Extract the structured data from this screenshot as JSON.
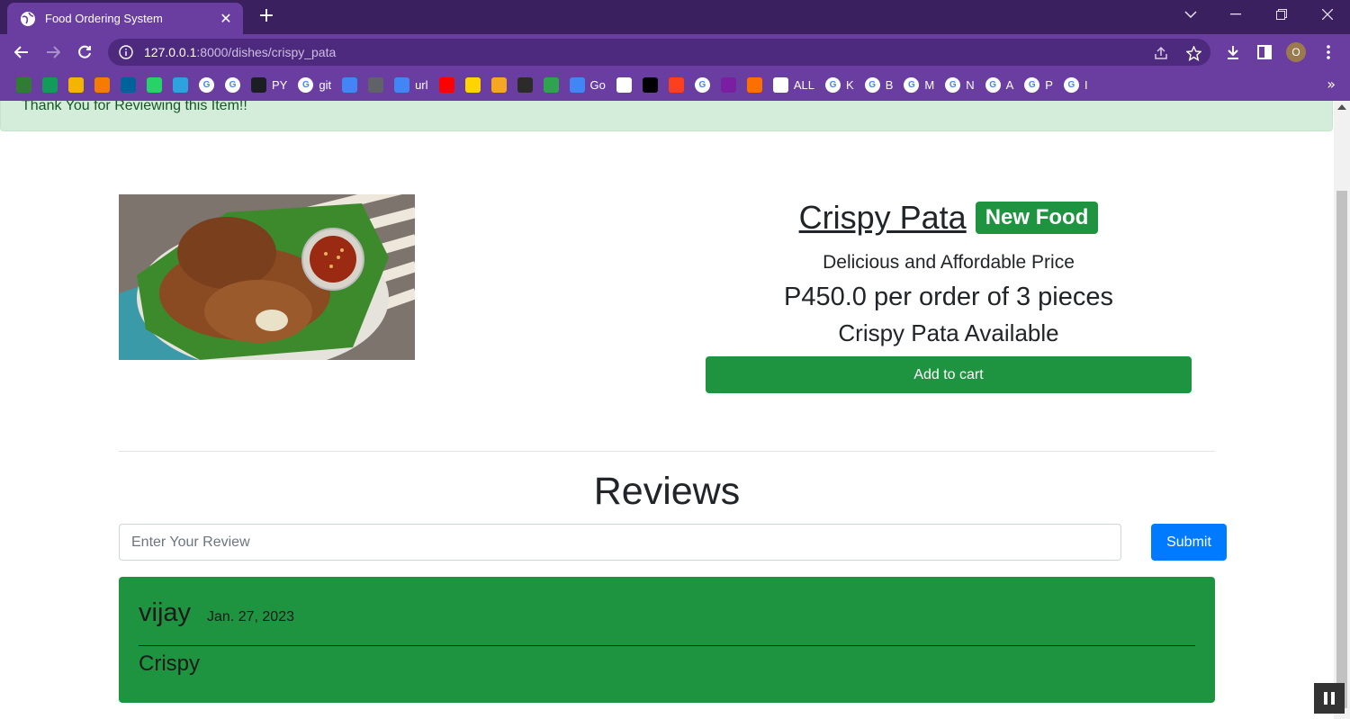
{
  "browser": {
    "tab_title": "Food Ordering System",
    "url_host": "127.0.0.1",
    "url_path": ":8000/dishes/crispy_pata",
    "profile_initial": "O",
    "bookmarks": [
      {
        "icon": "drive-icon",
        "label": "",
        "color": "#2e7d32"
      },
      {
        "icon": "plus-icon",
        "label": "",
        "color": "#0f9d58"
      },
      {
        "icon": "slides-icon",
        "label": "",
        "color": "#f4b400"
      },
      {
        "icon": "analytics-icon",
        "label": "",
        "color": "#f57c00"
      },
      {
        "icon": "ieee-icon",
        "label": "",
        "color": "#00629b"
      },
      {
        "icon": "whatsapp-icon",
        "label": "",
        "color": "#25d366"
      },
      {
        "icon": "telegram-icon",
        "label": "",
        "color": "#2aa3df"
      },
      {
        "icon": "google-icon",
        "label": "",
        "color": "#ffffff"
      },
      {
        "icon": "google-icon",
        "label": "",
        "color": "#ffffff"
      },
      {
        "icon": "github-icon",
        "label": "PY",
        "color": "#1b1f23"
      },
      {
        "icon": "google-icon",
        "label": "git",
        "color": "#ffffff"
      },
      {
        "icon": "docs-icon",
        "label": "",
        "color": "#4285f4"
      },
      {
        "icon": "store-icon",
        "label": "",
        "color": "#5f6368"
      },
      {
        "icon": "wifi-icon",
        "label": "url",
        "color": "#4285f4"
      },
      {
        "icon": "youtube-icon",
        "label": "",
        "color": "#ff0000"
      },
      {
        "icon": "p-icon",
        "label": "",
        "color": "#ffd400"
      },
      {
        "icon": "film-icon",
        "label": "",
        "color": "#f5a623"
      },
      {
        "icon": "lion-icon",
        "label": "",
        "color": "#2b2b2b"
      },
      {
        "icon": "circle-icon",
        "label": "",
        "color": "#2ea44f"
      },
      {
        "icon": "go-icon",
        "label": "Go",
        "color": "#4285f4"
      },
      {
        "icon": "notion-icon",
        "label": "",
        "color": "#ffffff"
      },
      {
        "icon": "cl-icon",
        "label": "",
        "color": "#000000"
      },
      {
        "icon": "yandex-icon",
        "label": "",
        "color": "#fc3f1d"
      },
      {
        "icon": "google-icon",
        "label": "",
        "color": "#ffffff"
      },
      {
        "icon": "rocket-icon",
        "label": "",
        "color": "#7b1fa2"
      },
      {
        "icon": "eye-icon",
        "label": "",
        "color": "#ff6f00"
      },
      {
        "icon": "globe-icon",
        "label": "ALL",
        "color": "#ffffff"
      },
      {
        "icon": "google-icon",
        "label": "K",
        "color": "#ffffff"
      },
      {
        "icon": "google-icon",
        "label": "B",
        "color": "#ffffff"
      },
      {
        "icon": "google-icon",
        "label": "M",
        "color": "#ffffff"
      },
      {
        "icon": "google-icon",
        "label": "N",
        "color": "#ffffff"
      },
      {
        "icon": "google-icon",
        "label": "A",
        "color": "#ffffff"
      },
      {
        "icon": "google-icon",
        "label": "P",
        "color": "#ffffff"
      },
      {
        "icon": "google-icon",
        "label": "I",
        "color": "#ffffff"
      }
    ],
    "more_bookmarks": "»"
  },
  "page": {
    "alert_message": "Thank You for Reviewing this Item!!",
    "dish": {
      "name": "Crispy Pata",
      "badge": "New Food",
      "tagline": "Delicious and Affordable Price",
      "price": "P450.0 per order of 3 pieces",
      "availability": "Crispy Pata Available",
      "add_to_cart_label": "Add to cart"
    },
    "reviews": {
      "heading": "Reviews",
      "input_placeholder": "Enter Your Review",
      "submit_label": "Submit",
      "items": [
        {
          "user": "vijay",
          "date": "Jan. 27, 2023",
          "text": "Crispy"
        }
      ]
    }
  },
  "colors": {
    "success_green": "#1e9441",
    "alert_bg": "#d4edda",
    "primary_blue": "#007bff",
    "browser_purple": "#6a3ea0"
  }
}
